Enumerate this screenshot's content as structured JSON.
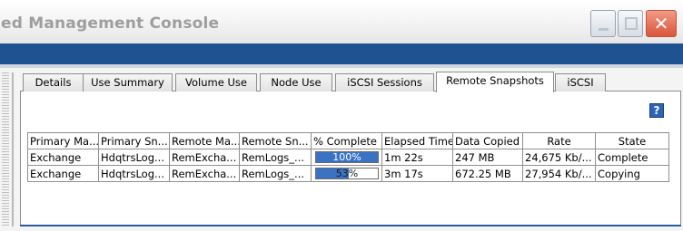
{
  "window": {
    "title": "ed Management Console",
    "controls": {
      "minimize_icon": "minimize-icon",
      "maximize_icon": "maximize-icon",
      "close_icon": "close-icon",
      "close_glyph": "✕"
    },
    "colors": {
      "title_band": "#1e5291",
      "close_button": "#d9553a",
      "progress_fill": "#3b73c4"
    }
  },
  "tabs": [
    {
      "label": "Details"
    },
    {
      "label": "Use Summary"
    },
    {
      "label": "Volume Use"
    },
    {
      "label": "Node Use"
    },
    {
      "label": "iSCSI Sessions"
    },
    {
      "label": "Remote Snapshots",
      "active": true
    },
    {
      "label": "iSCSI"
    }
  ],
  "help": {
    "label": "?",
    "icon": "help-icon"
  },
  "table": {
    "columns": [
      "Primary Ma...",
      "Primary Sn...",
      "Remote Ma...",
      "Remote Sn...",
      "% Complete",
      "Elapsed Time",
      "Data Copied",
      "Rate",
      "State"
    ],
    "rows": [
      {
        "primary_management_group": "Exchange",
        "primary_snapshot": "HdqtrsLog...",
        "remote_management_group": "RemExcha...",
        "remote_snapshot": "RemLogs_...",
        "percent_complete": 100,
        "percent_label": "100%",
        "elapsed_time": "1m 22s",
        "data_copied": "247 MB",
        "rate": "24,675 Kb/...",
        "state": "Complete"
      },
      {
        "primary_management_group": "Exchange",
        "primary_snapshot": "HdqtrsLog...",
        "remote_management_group": "RemExcha...",
        "remote_snapshot": "RemLogs_...",
        "percent_complete": 53,
        "percent_label": "53%",
        "elapsed_time": "3m 17s",
        "data_copied": "672.25 MB",
        "rate": "27,954 Kb/...",
        "state": "Copying"
      }
    ]
  }
}
